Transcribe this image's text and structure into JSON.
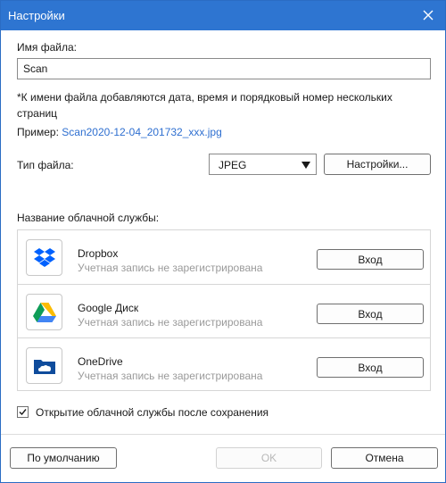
{
  "window": {
    "title": "Настройки"
  },
  "filename": {
    "label": "Имя файла:",
    "value": "Scan",
    "note": "*К имени файла добавляются дата, время и порядковый номер нескольких страниц",
    "example_label": "Пример:",
    "example_value": "Scan2020-12-04_201732_xxx.jpg"
  },
  "filetype": {
    "label": "Тип файла:",
    "selected": "JPEG",
    "settings_button": "Настройки..."
  },
  "cloud": {
    "label": "Название облачной службы:",
    "services": [
      {
        "name": "Dropbox",
        "status": "Учетная запись не зарегистрирована",
        "button": "Вход",
        "icon": "dropbox-icon"
      },
      {
        "name": "Google Диск",
        "status": "Учетная запись не зарегистрирована",
        "button": "Вход",
        "icon": "google-drive-icon"
      },
      {
        "name": "OneDrive",
        "status": "Учетная запись не зарегистрирована",
        "button": "Вход",
        "icon": "onedrive-icon"
      }
    ]
  },
  "open_after_save": {
    "label": "Открытие облачной службы после сохранения",
    "checked": true
  },
  "footer": {
    "default_button": "По умолчанию",
    "ok_button": "OK",
    "cancel_button": "Отмена"
  },
  "colors": {
    "accent": "#2e75d1",
    "link": "#2e6fd0",
    "dropbox": "#0061fe",
    "onedrive": "#0f4c9c"
  }
}
